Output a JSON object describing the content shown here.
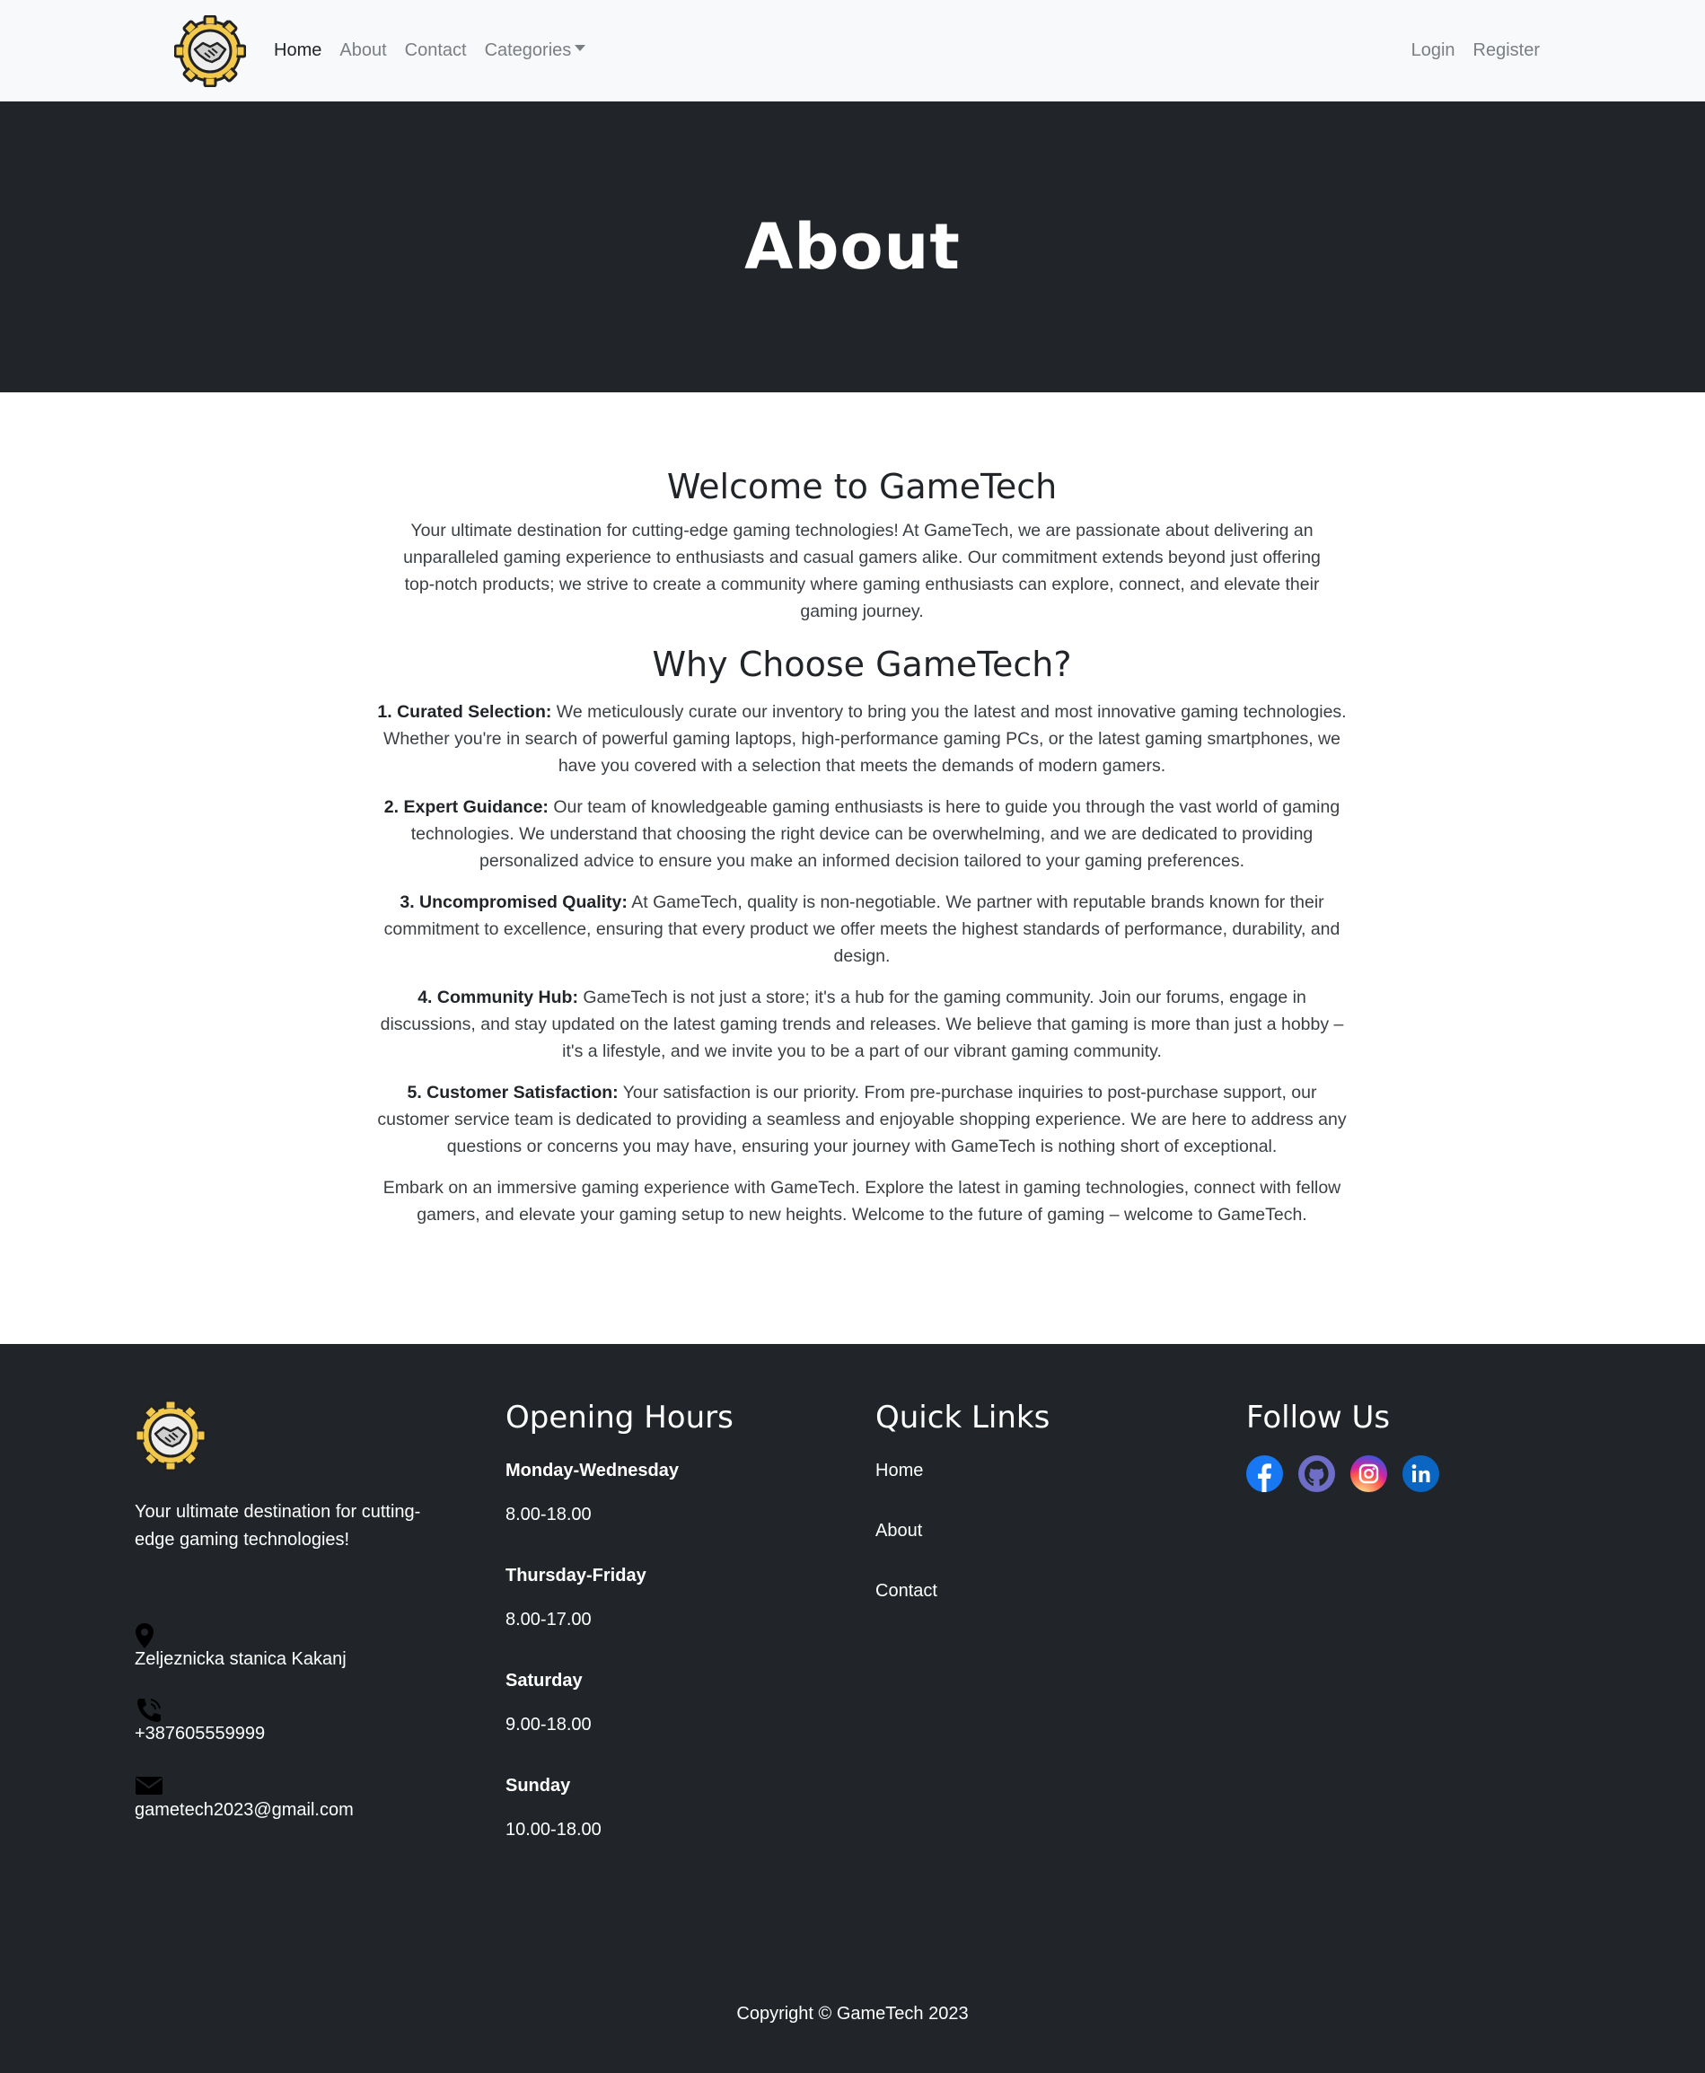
{
  "nav": {
    "logo_icon": "handshake-gear-logo",
    "home": "Home",
    "about": "About",
    "contact": "Contact",
    "categories": "Categories",
    "login": "Login",
    "register": "Register"
  },
  "hero": {
    "title": "About"
  },
  "main": {
    "welcome_title": "Welcome to GameTech",
    "intro": "Your ultimate destination for cutting-edge gaming technologies! At GameTech, we are passionate about delivering an unparalleled gaming experience to enthusiasts and casual gamers alike. Our commitment extends beyond just offering top-notch products; we strive to create a community where gaming enthusiasts can explore, connect, and elevate their gaming journey.",
    "why_title": "Why Choose GameTech?",
    "reasons": [
      {
        "title": "1. Curated Selection:",
        "text": " We meticulously curate our inventory to bring you the latest and most innovative gaming technologies. Whether you're in search of powerful gaming laptops, high-performance gaming PCs, or the latest gaming smartphones, we have you covered with a selection that meets the demands of modern gamers."
      },
      {
        "title": "2. Expert Guidance:",
        "text": " Our team of knowledgeable gaming enthusiasts is here to guide you through the vast world of gaming technologies. We understand that choosing the right device can be overwhelming, and we are dedicated to providing personalized advice to ensure you make an informed decision tailored to your gaming preferences."
      },
      {
        "title": "3. Uncompromised Quality:",
        "text": " At GameTech, quality is non-negotiable. We partner with reputable brands known for their commitment to excellence, ensuring that every product we offer meets the highest standards of performance, durability, and design."
      },
      {
        "title": "4. Community Hub:",
        "text": " GameTech is not just a store; it's a hub for the gaming community. Join our forums, engage in discussions, and stay updated on the latest gaming trends and releases. We believe that gaming is more than just a hobby – it's a lifestyle, and we invite you to be a part of our vibrant gaming community."
      },
      {
        "title": "5. Customer Satisfaction:",
        "text": " Your satisfaction is our priority. From pre-purchase inquiries to post-purchase support, our customer service team is dedicated to providing a seamless and enjoyable shopping experience. We are here to address any questions or concerns you may have, ensuring your journey with GameTech is nothing short of exceptional."
      }
    ],
    "closing": "Embark on an immersive gaming experience with GameTech. Explore the latest in gaming technologies, connect with fellow gamers, and elevate your gaming setup to new heights. Welcome to the future of gaming – welcome to GameTech."
  },
  "footer": {
    "tagline": "Your ultimate destination for cutting-edge gaming technologies!",
    "address": "Zeljeznicka stanica Kakanj",
    "phone": "+387605559999",
    "email": "gametech2023@gmail.com",
    "hours_title": "Opening Hours",
    "hours": [
      {
        "day": "Monday-Wednesday",
        "time": "8.00-18.00"
      },
      {
        "day": "Thursday-Friday",
        "time": "8.00-17.00"
      },
      {
        "day": "Saturday",
        "time": "9.00-18.00"
      },
      {
        "day": "Sunday",
        "time": "10.00-18.00"
      }
    ],
    "links_title": "Quick Links",
    "links": [
      "Home",
      "About",
      "Contact"
    ],
    "follow_title": "Follow Us",
    "socials": [
      "facebook-icon",
      "github-icon",
      "instagram-icon",
      "linkedin-icon"
    ],
    "copyright": "Copyright © GameTech 2023"
  },
  "colors": {
    "navbar_bg": "#f8f9fa",
    "dark_bg": "#212529",
    "logo_gear": "#f2c94c",
    "facebook": "#1877f2",
    "github": "#6e6ec9",
    "linkedin": "#0a66c2"
  }
}
